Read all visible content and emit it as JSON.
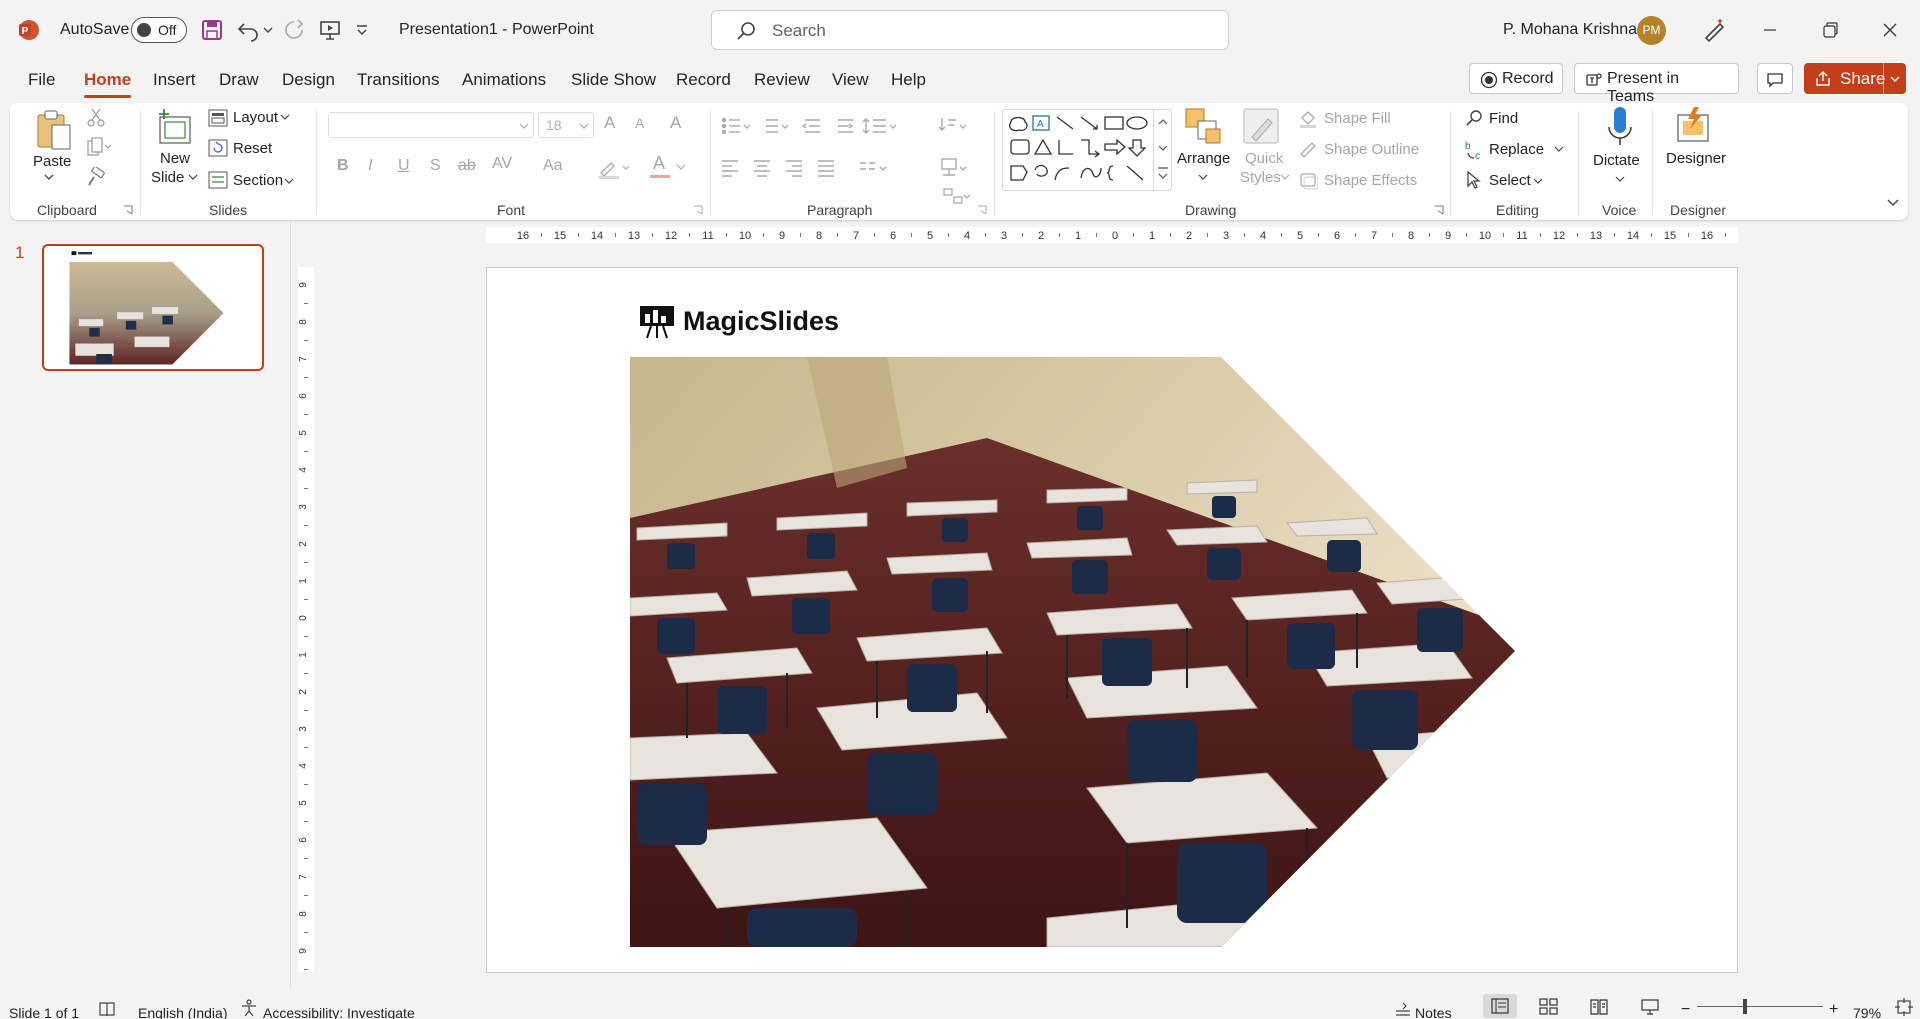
{
  "titlebar": {
    "autosave_label": "AutoSave",
    "autosave_state": "Off",
    "document_title": "Presentation1  -  PowerPoint",
    "search_placeholder": "Search",
    "user_name": "P. Mohana Krishna",
    "user_initials": "PM"
  },
  "tabs": [
    {
      "label": "File"
    },
    {
      "label": "Home"
    },
    {
      "label": "Insert"
    },
    {
      "label": "Draw"
    },
    {
      "label": "Design"
    },
    {
      "label": "Transitions"
    },
    {
      "label": "Animations"
    },
    {
      "label": "Slide Show"
    },
    {
      "label": "Record"
    },
    {
      "label": "Review"
    },
    {
      "label": "View"
    },
    {
      "label": "Help"
    }
  ],
  "active_tab": "Home",
  "header_buttons": {
    "record": "Record",
    "present_in_teams": "Present in Teams",
    "share": "Share"
  },
  "ribbon": {
    "clipboard": {
      "group": "Clipboard",
      "paste": "Paste"
    },
    "slides": {
      "group": "Slides",
      "new_slide_1": "New",
      "new_slide_2": "Slide",
      "layout": "Layout",
      "reset": "Reset",
      "section": "Section"
    },
    "font": {
      "group": "Font",
      "size": "18",
      "bold": "B",
      "italic": "I",
      "underline": "U",
      "shadow": "S",
      "strike": "ab",
      "spacing": "AV",
      "case": "Aa",
      "grow": "A",
      "shrink": "A",
      "clear": "A",
      "color": "A"
    },
    "paragraph": {
      "group": "Paragraph"
    },
    "drawing": {
      "group": "Drawing",
      "arrange": "Arrange",
      "quick_styles_1": "Quick",
      "quick_styles_2": "Styles",
      "shape_fill": "Shape Fill",
      "shape_outline": "Shape Outline",
      "shape_effects": "Shape Effects"
    },
    "editing": {
      "group": "Editing",
      "find": "Find",
      "replace": "Replace",
      "select": "Select"
    },
    "voice": {
      "group": "Voice",
      "dictate": "Dictate"
    },
    "designer": {
      "group": "Designer",
      "designer": "Designer"
    }
  },
  "slides_pane": {
    "slide_number": "1"
  },
  "slide": {
    "logo_text": "MagicSlides",
    "image_description_icon": "classroom-photo"
  },
  "rulers": {
    "horizontal": [
      "16",
      "15",
      "14",
      "13",
      "12",
      "11",
      "10",
      "9",
      "8",
      "7",
      "6",
      "5",
      "4",
      "3",
      "2",
      "1",
      "0",
      "1",
      "2",
      "3",
      "4",
      "5",
      "6",
      "7",
      "8",
      "9",
      "10",
      "11",
      "12",
      "13",
      "14",
      "15",
      "16"
    ],
    "vertical": [
      "9",
      "8",
      "7",
      "6",
      "5",
      "4",
      "3",
      "2",
      "1",
      "0",
      "1",
      "2",
      "3",
      "4",
      "5",
      "6",
      "7",
      "8",
      "9"
    ]
  },
  "statusbar": {
    "slide_info": "Slide 1 of 1",
    "language": "English (India)",
    "accessibility": "Accessibility: Investigate",
    "notes": "Notes",
    "zoom": "79%",
    "zoom_minus": "−",
    "zoom_plus": "+"
  },
  "colors": {
    "accent": "#c43e1c",
    "background": "#f3f3f3",
    "slide": "#ffffff"
  }
}
